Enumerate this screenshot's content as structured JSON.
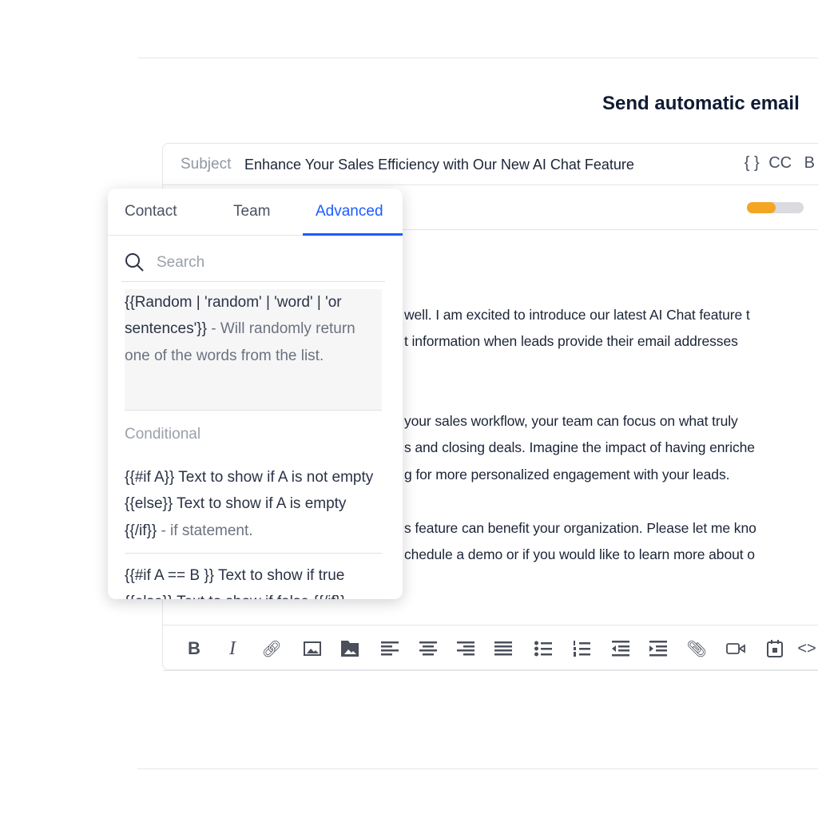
{
  "header": {
    "title": "Send automatic email"
  },
  "subject": {
    "label": "Subject",
    "value": "Enhance Your Sales Efficiency with Our New AI Chat Feature",
    "variables": "{ }",
    "cc": "CC",
    "bcc": "B"
  },
  "toggle": {
    "on": true,
    "accent": "#f5a524"
  },
  "body_lines": [
    "well. I am excited to introduce our latest AI Chat feature t",
    "t information when leads provide their email addresses",
    "your sales workflow, your team can focus on what truly",
    "s and closing deals. Imagine the impact of having enriche",
    "g for more personalized engagement with your leads.",
    "s feature can benefit your organization. Please let me kno",
    "chedule a demo or if you would like to learn more about o"
  ],
  "toolbar": [
    "bold-icon",
    "italic-icon",
    "link-icon",
    "image-icon",
    "image-filled-icon",
    "align-left-icon",
    "align-center-icon",
    "align-right-icon",
    "align-justify-icon",
    "bullet-list-icon",
    "numbered-list-icon",
    "outdent-icon",
    "indent-icon",
    "attachment-icon",
    "video-icon",
    "calendar-icon",
    "code-icon"
  ],
  "popup": {
    "tabs": [
      "Contact",
      "Team",
      "Advanced"
    ],
    "active_tab": "Advanced",
    "accent": "#1a5cff",
    "search_placeholder": "Search",
    "items": [
      {
        "code": "{{Random | 'random' | 'word' | 'or sentences'}}",
        "desc": " - Will randomly return one of the words from the list."
      },
      {
        "code": "{{#if A}} Text to show if A is not empty {{else}} Text to show if A is empty {{/if}}",
        "desc": " - if statement."
      },
      {
        "code": "{{#if A == B }} Text to show if true {{else}} Text to show if false {{/if}}",
        "desc": ""
      }
    ],
    "section": "Conditional"
  }
}
